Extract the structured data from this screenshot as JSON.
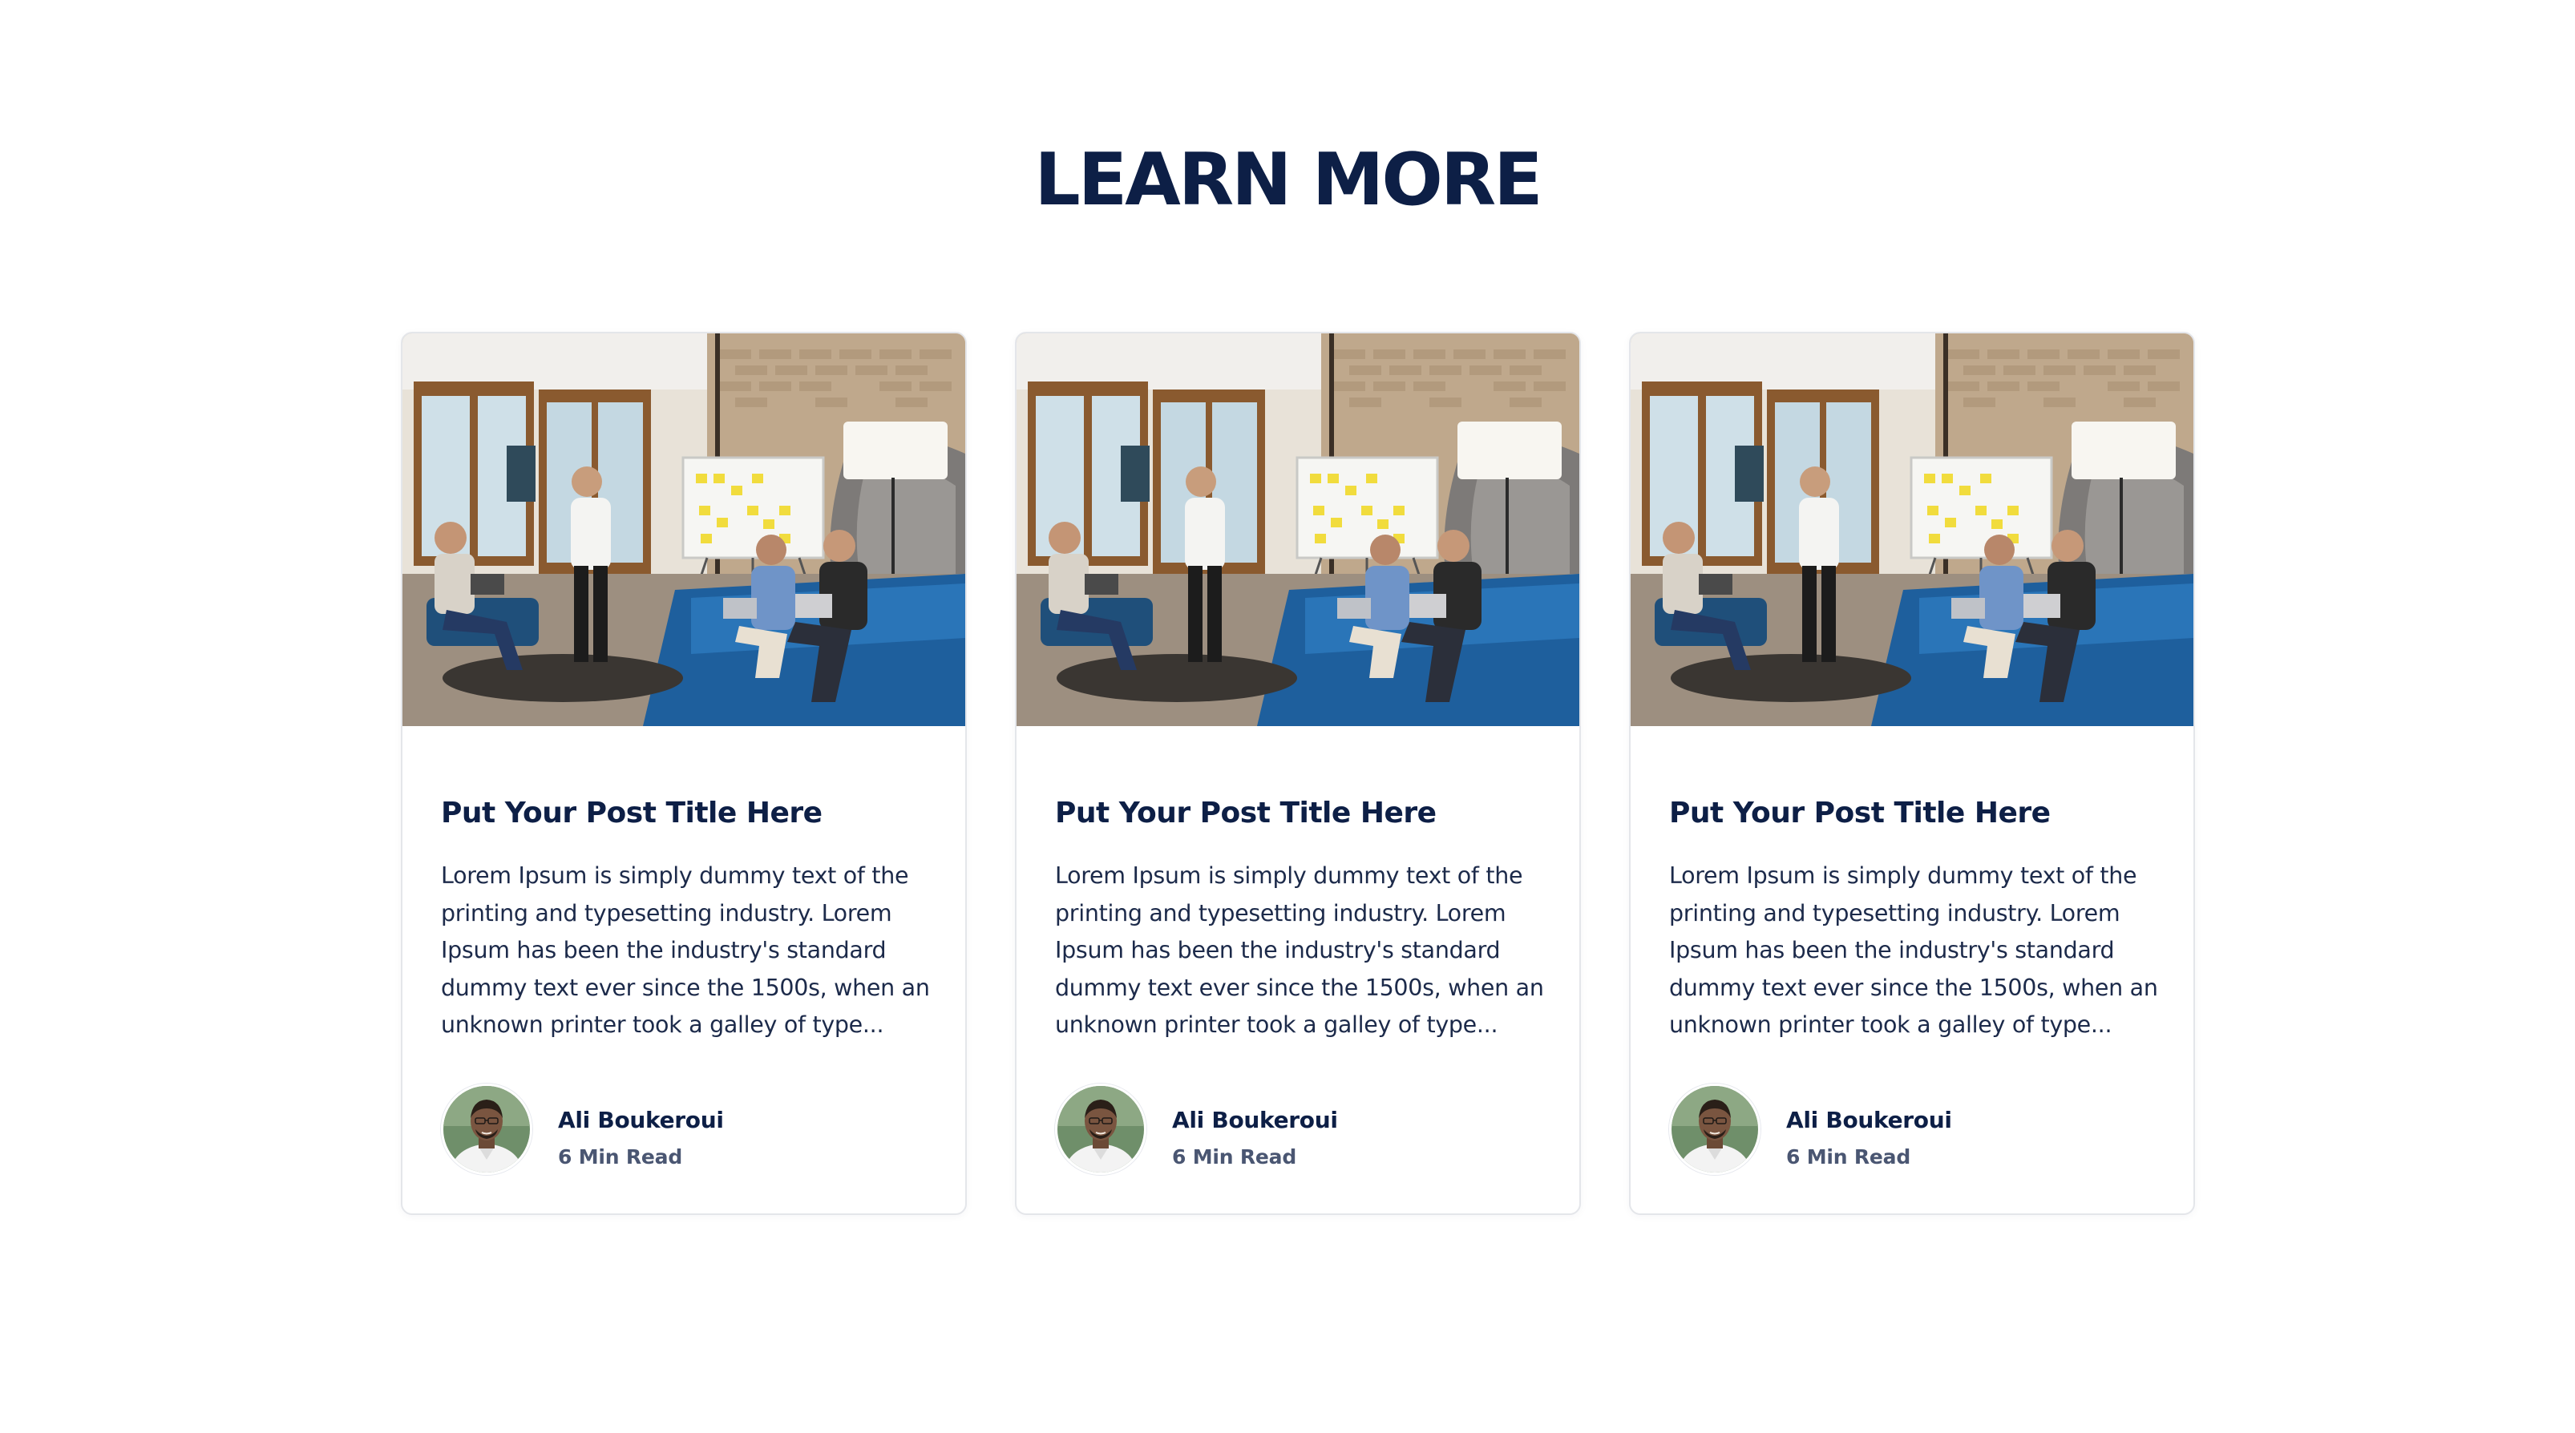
{
  "section": {
    "title": "LEARN MORE"
  },
  "colors": {
    "heading": "#0d1f46",
    "body_text": "#1c2a4a",
    "meta_text": "#4a5672",
    "card_border": "#e4e6ea",
    "background": "#ffffff"
  },
  "posts": [
    {
      "image": "office-meeting-photo",
      "title": "Put Your Post Title Here",
      "excerpt": "Lorem Ipsum is simply dummy text of the printing and typesetting industry. Lorem Ipsum has been the industry's standard dummy text ever since the 1500s, when an unknown printer took a galley of type...",
      "author": {
        "name": "Ali Boukeroui",
        "avatar": "author-avatar-photo"
      },
      "read_time": "6 Min Read"
    },
    {
      "image": "office-meeting-photo",
      "title": "Put Your Post Title Here",
      "excerpt": "Lorem Ipsum is simply dummy text of the printing and typesetting industry. Lorem Ipsum has been the industry's standard dummy text ever since the 1500s, when an unknown printer took a galley of type...",
      "author": {
        "name": "Ali Boukeroui",
        "avatar": "author-avatar-photo"
      },
      "read_time": "6 Min Read"
    },
    {
      "image": "office-meeting-photo",
      "title": "Put Your Post Title Here",
      "excerpt": "Lorem Ipsum is simply dummy text of the printing and typesetting industry. Lorem Ipsum has been the industry's standard dummy text ever since the 1500s, when an unknown printer took a galley of type...",
      "author": {
        "name": "Ali Boukeroui",
        "avatar": "author-avatar-photo"
      },
      "read_time": "6 Min Read"
    }
  ]
}
